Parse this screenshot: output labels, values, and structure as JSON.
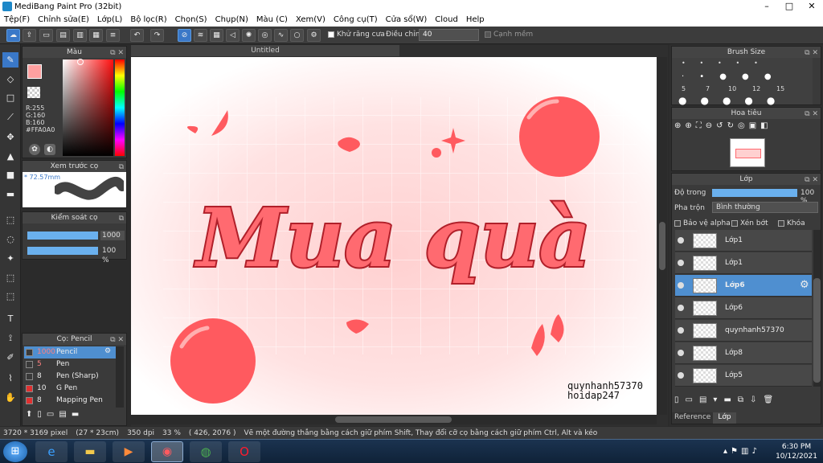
{
  "window": {
    "title": "MediBang Paint Pro (32bit)"
  },
  "menu": [
    "Tệp(F)",
    "Chỉnh sửa(E)",
    "Lớp(L)",
    "Bộ lọc(R)",
    "Chọn(S)",
    "Chụp(N)",
    "Màu (C)",
    "Xem(V)",
    "Công cụ(T)",
    "Cửa sổ(W)",
    "Cloud",
    "Help"
  ],
  "toolbar": {
    "antialias_label": "Khử răng cưa",
    "adjust_label": "Điều chỉnh",
    "adjust_value": "40",
    "snap_label": "Cạnh mềm"
  },
  "color_panel": {
    "title": "Màu",
    "r": "R:255",
    "g": "G:160",
    "b": "B:160",
    "hex": "#FFA0A0",
    "accent": "#ffa0a0"
  },
  "preview_panel": {
    "title": "Xem trước cọ",
    "size": "* 72.57mm"
  },
  "brush_control": {
    "title": "Kiểm soát cọ",
    "size_value": "1000",
    "opacity_value": "100 %"
  },
  "brush_panel": {
    "title": "Cọ: Pencil",
    "items": [
      {
        "size": "1000",
        "name": "Pencil",
        "color": "#3a3a3a"
      },
      {
        "size": "5",
        "name": "Pen",
        "color": "#3a3a3a"
      },
      {
        "size": "8",
        "name": "Pen (Sharp)",
        "color": "#3a3a3a"
      },
      {
        "size": "10",
        "name": "G Pen",
        "color": "#e03030"
      },
      {
        "size": "8",
        "name": "Mapping Pen",
        "color": "#e03030"
      }
    ]
  },
  "document": {
    "tab": "Untitled",
    "title_text": "Mua quà",
    "watermark1": "quynhanh57370",
    "watermark2": "hoidap247",
    "accent": "#ff5a5f"
  },
  "brush_size_panel": {
    "title": "Brush Size",
    "sizes": [
      "5",
      "7",
      "10",
      "12",
      "15"
    ]
  },
  "navigator_panel": {
    "title": "Hoa tiêu"
  },
  "layer_panel": {
    "title": "Lớp",
    "opacity_label": "Độ trong",
    "opacity_value": "100 %",
    "blend_label": "Pha trộn",
    "blend_value": "Bình thường",
    "protect_alpha": "Bảo vệ alpha",
    "clipping": "Xén bớt",
    "lock": "Khóa",
    "layers": [
      {
        "name": "Lớp1"
      },
      {
        "name": "Lớp1"
      },
      {
        "name": "Lớp6"
      },
      {
        "name": "Lớp6"
      },
      {
        "name": "quynhanh57370"
      },
      {
        "name": "Lớp8"
      },
      {
        "name": "Lớp5"
      }
    ],
    "tabs": [
      "Reference",
      "Lớp"
    ]
  },
  "status": {
    "dimensions": "3720 * 3169 pixel",
    "physical": "(27 * 23cm)",
    "dpi": "350 dpi",
    "zoom": "33 %",
    "coords": "( 426, 2076 )",
    "hint": "Vẽ một đường thẳng bằng cách giữ phím Shift, Thay đổi cỡ cọ bằng cách giữ phím Ctrl, Alt và kéo"
  },
  "taskbar": {
    "time": "6:30 PM",
    "date": "10/12/2021"
  }
}
